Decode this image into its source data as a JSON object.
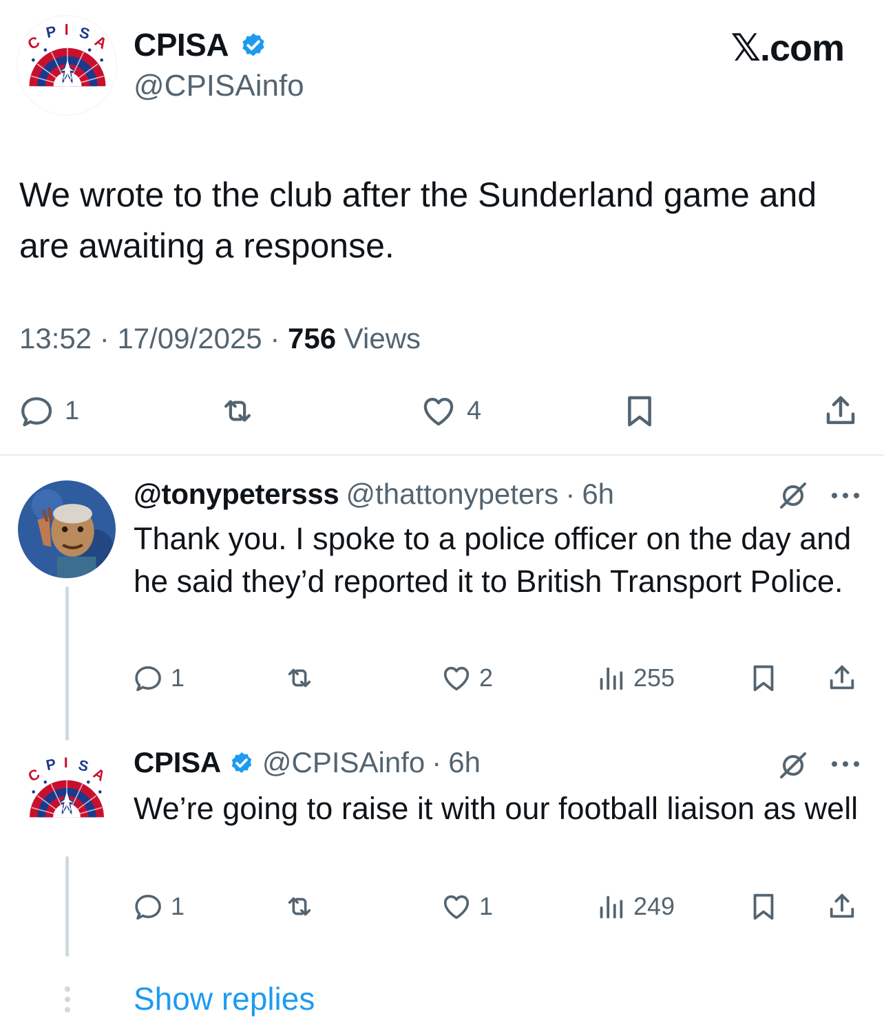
{
  "brand": {
    "label": "𝕏.com"
  },
  "main_tweet": {
    "author_name": "CPISA",
    "handle": "@CPISAinfo",
    "logo_letters": [
      "C",
      "P",
      "I",
      "S",
      "A"
    ],
    "text": "We wrote to the club after the Sunderland game and are awaiting a response.",
    "time": "13:52",
    "date": "17/09/2025",
    "views_count": "756",
    "views_label": "Views",
    "separator": "·",
    "reply_count": "1",
    "like_count": "4"
  },
  "replies": [
    {
      "author_name": "@tonypetersss",
      "handle": "@thattonypeters",
      "separator": "·",
      "age": "6h",
      "text": "Thank you. I spoke to a police officer on the day and he said they’d reported it to British Transport Police.",
      "reply_count": "1",
      "like_count": "2",
      "views": "255"
    },
    {
      "author_name": "CPISA",
      "handle": "@CPISAinfo",
      "separator": "·",
      "age": "6h",
      "text": "We’re going to raise it with our football liaison as well",
      "reply_count": "1",
      "like_count": "1",
      "views": "249"
    }
  ],
  "show_replies": "Show replies",
  "colors": {
    "accent": "#1d9bf0",
    "muted": "#536471",
    "verified": "#1d9bf0",
    "thread_line": "#cfd9de"
  }
}
